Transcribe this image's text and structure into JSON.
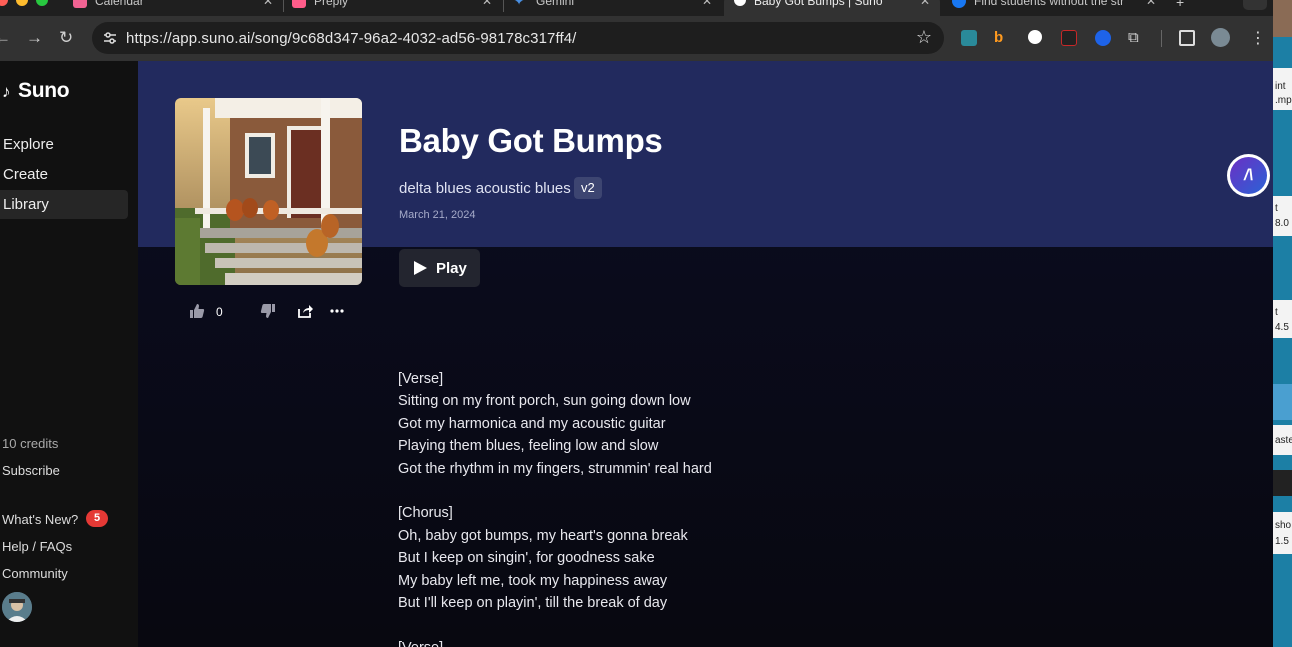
{
  "browser": {
    "tabs": [
      {
        "title": "Calendar",
        "favicon_color": "#f06292"
      },
      {
        "title": "Preply",
        "favicon_color": "#ff5c8a"
      },
      {
        "title": "Gemini",
        "favicon_color": "#4a90e2"
      },
      {
        "title": "Baby Got Bumps | Suno",
        "favicon_color": "#ffffff",
        "active": true
      },
      {
        "title": "Find students without the str",
        "favicon_color": "#1877f2"
      }
    ],
    "url": "https://app.suno.ai/song/9c68d347-96a2-4032-ad56-98178c317ff4/"
  },
  "sidebar": {
    "logo": "Suno",
    "nav": [
      {
        "label": "Explore"
      },
      {
        "label": "Create"
      },
      {
        "label": "Library",
        "active": true
      }
    ],
    "credits": "10 credits",
    "subscribe": "Subscribe",
    "whats_new": "What's New?",
    "whats_new_count": "5",
    "help": "Help / FAQs",
    "community": "Community"
  },
  "song": {
    "title": "Baby Got Bumps",
    "style": "delta blues acoustic blues",
    "version": "v2",
    "date": "March 21, 2024",
    "play_label": "Play",
    "likes": "0",
    "lyrics": "[Verse]\nSitting on my front porch, sun going down low\nGot my harmonica and my acoustic guitar\nPlaying them blues, feeling low and slow\nGot the rhythm in my fingers, strummin' real hard\n\n[Chorus]\nOh, baby got bumps, my heart's gonna break\nBut I keep on singin', for goodness sake\nMy baby left me, took my happiness away\nBut I'll keep on playin', till the break of day\n\n[Verse]"
  },
  "peek": {
    "lines": [
      "int",
      ".mp",
      "t",
      "8.0",
      "t",
      "4.5",
      "aste",
      "sho",
      "1.5"
    ]
  },
  "colors": {
    "hero": "#222a5e",
    "badge": "#e53935",
    "sidebar": "#111111"
  }
}
